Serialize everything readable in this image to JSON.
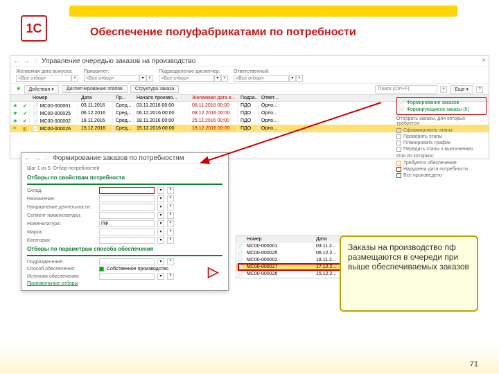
{
  "slide": {
    "title": "Обеспечение полуфабрикатами по потребности",
    "page": "71",
    "logo": "1С"
  },
  "window": {
    "title": "Управление очередью заказов на производство",
    "filters": {
      "f1_label": "Желаемая дата выпуска:",
      "f2_label": "Приоритет:",
      "f3_label": "Подразделение-диспетчер:",
      "f4_label": "Ответственный:",
      "placeholder": "<Все отбор>"
    },
    "toolbar": {
      "actions": "Действия ▾",
      "dispatch": "Диспетчирование этапов",
      "structure": "Структура заказа",
      "search_ph": "Поиск (Ctrl+F)",
      "more": "Еще ▾"
    },
    "headers": {
      "num": "Номер",
      "date": "Дата",
      "pr": "Пр...",
      "start": "Начало произво...",
      "want": "Желаемая дата в...",
      "dept": "Подра...",
      "resp": "Ответ..."
    },
    "rows": [
      {
        "num": "МС00-000001",
        "date": "03.11.2016",
        "pr": "Сред...",
        "start": "03.11.2016 00:00",
        "want": "08.11.2016 00:00",
        "dept": "ПДО",
        "resp": "Орло..."
      },
      {
        "num": "МС00-000025",
        "date": "06.12.2016",
        "pr": "Сред...",
        "start": "06.12.2016 00:00",
        "want": "08.12.2016 00:00",
        "dept": "ПДО",
        "resp": "Орло..."
      },
      {
        "num": "МС00-000002",
        "date": "18.11.2016",
        "pr": "Сред...",
        "start": "18.11.2016 00:00",
        "want": "25.11.2016 00:00",
        "dept": "ПДО",
        "resp": "Орло..."
      },
      {
        "num": "МС00-000026",
        "date": "15.12.2016",
        "pr": "Сред...",
        "start": "15.12.2016 00:00",
        "want": "18.12.2016 00:00",
        "dept": "ПДО",
        "resp": "Орло..."
      }
    ]
  },
  "side": {
    "form": "Формирование заказов",
    "forming": "Формирующиеся заказы (0)",
    "header2": "Отобрать заказы, для которых требуется:",
    "items": [
      "Сформировать этапы",
      "Проверить этапы",
      "Планировать график",
      "Передать этапы к выполнению"
    ],
    "header3": "Или по которым:",
    "items2": [
      "Требуется обеспечение",
      "Нарушена дата потребности",
      "Все произведено"
    ]
  },
  "dialog": {
    "title": "Формирование заказов по потребностям",
    "step": "Шаг 1 из 5. Отбор потребностей",
    "section1": "Отборы по свойствам потребности",
    "fields1": [
      {
        "label": "Склад:",
        "val": ""
      },
      {
        "label": "Назначение:",
        "val": ""
      },
      {
        "label": "Направление деятельности:",
        "val": ""
      },
      {
        "label": "Сегмент номенклатуры:",
        "val": ""
      },
      {
        "label": "Номенклатура:",
        "val": "ПФ"
      },
      {
        "label": "Марка:",
        "val": ""
      },
      {
        "label": "Категория:",
        "val": ""
      }
    ],
    "section2": "Отборы по параметрам способа обеспечения",
    "fields2": [
      {
        "label": "Подразделение:",
        "val": ""
      },
      {
        "label": "Способ обеспечения:",
        "chk": "Собственное производство"
      },
      {
        "label": "Источник обеспечения:",
        "val": ""
      }
    ],
    "link": "Произвольные отборы"
  },
  "mini": {
    "h_num": "Номер",
    "h_date": "Дата",
    "rows": [
      {
        "num": "МС00-000001",
        "date": "03.11.2..."
      },
      {
        "num": "МС00-000025",
        "date": "06.12.2..."
      },
      {
        "num": "МС00-000002",
        "date": "18.11.2..."
      },
      {
        "num": "МС00-000027",
        "date": "17.12.2..."
      },
      {
        "num": "МС00-000026",
        "date": "15.12.2..."
      }
    ]
  },
  "callout": "Заказы на производство пф размещаются в очереди при выше обеспечиваемых заказов"
}
